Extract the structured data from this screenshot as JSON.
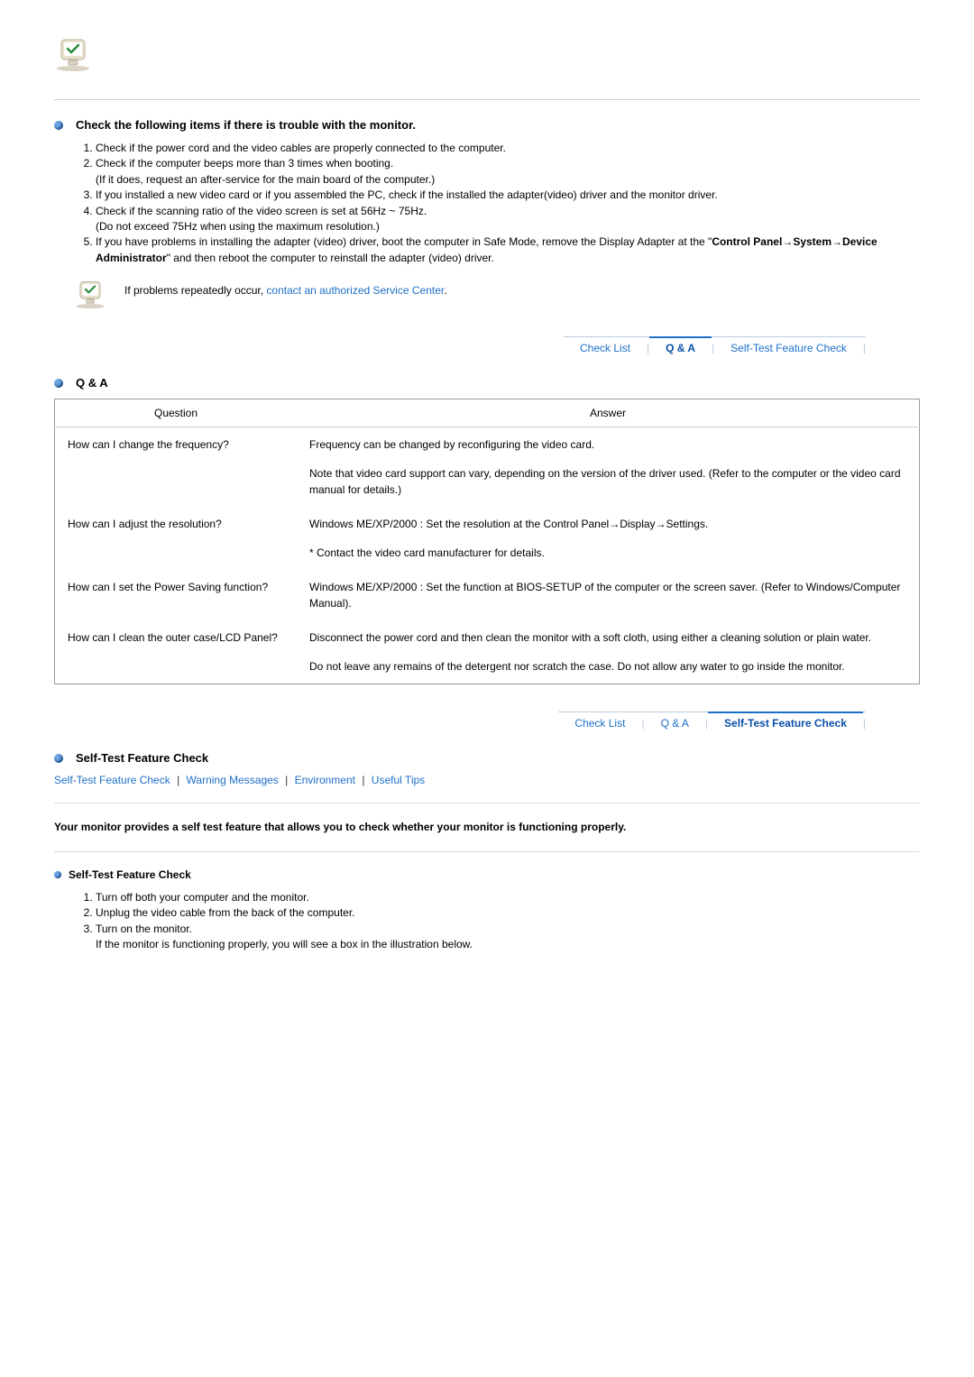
{
  "section1": {
    "title": "Check the following items if there is trouble with the monitor.",
    "items": [
      "Check if the power cord and the video cables are properly connected to the computer.",
      "Check if the computer beeps more than 3 times when booting.\n(If it does, request an after-service for the main board of the computer.)",
      "If you installed a new video card or if you assembled the PC, check if the installed the adapter(video) driver and the monitor driver.",
      "Check if the scanning ratio of the video screen is set at 56Hz ~ 75Hz.\n(Do not exceed 75Hz when using the maximum resolution.)",
      "If you have problems in installing the adapter (video) driver, boot the computer in Safe Mode, remove the Display Adapter at the \"Control Panel→System→Device Administrator\" and then reboot the computer to reinstall the adapter (video) driver."
    ],
    "note_prefix": "If problems repeatedly occur, ",
    "note_link": "contact an authorized Service Center",
    "note_suffix": "."
  },
  "tabs": {
    "checklist": "Check List",
    "qa": "Q & A",
    "selftest": "Self-Test Feature Check"
  },
  "qna": {
    "title": "Q & A",
    "head_q": "Question",
    "head_a": "Answer",
    "rows": [
      {
        "q": "How can I change the frequency?",
        "a1": "Frequency can be changed by reconfiguring the video card.",
        "a2": "Note that video card support can vary, depending on the version of the driver used. (Refer to the computer or the video card manual for details.)"
      },
      {
        "q": "How can I adjust the resolution?",
        "a1": "Windows ME/XP/2000 : Set the resolution at the Control Panel→Display→Settings.",
        "a2": "* Contact the video card manufacturer for details."
      },
      {
        "q": "How can I set the Power Saving function?",
        "a1": "Windows ME/XP/2000 : Set the function at BIOS-SETUP of the computer or the screen saver. (Refer to Windows/Computer Manual)."
      },
      {
        "q": "How can I clean the outer case/LCD Panel?",
        "a1": "Disconnect the power cord and then clean the monitor with a soft cloth, using either a cleaning solution or plain water.",
        "a2": "Do not leave any remains of the detergent nor scratch the case. Do not allow any water to go inside the monitor."
      }
    ]
  },
  "selftest": {
    "title": "Self-Test Feature Check",
    "crumbs": [
      "Self-Test Feature Check",
      "Warning Messages",
      "Environment",
      "Useful Tips"
    ],
    "intro": "Your monitor provides a self test feature that allows you to check whether your monitor is functioning properly.",
    "sub_title": "Self-Test Feature Check",
    "steps": [
      "Turn off both your computer and the monitor.",
      "Unplug the video cable from the back of the computer.",
      "Turn on the monitor.\nIf the monitor is functioning properly, you will see a box in the illustration below."
    ]
  }
}
